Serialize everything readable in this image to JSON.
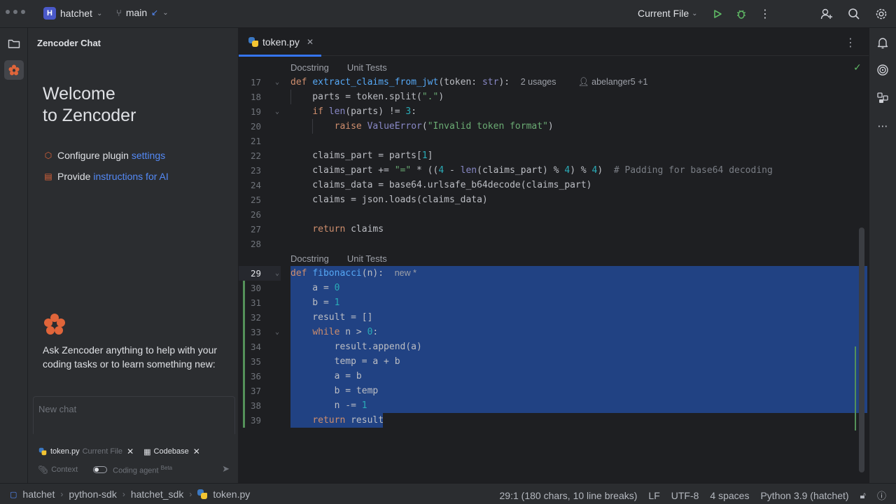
{
  "titlebar": {
    "project_badge": "H",
    "project_name": "hatchet",
    "branch": "main",
    "run_config": "Current File"
  },
  "chat": {
    "panel_title": "Zencoder Chat",
    "welcome_line1": "Welcome",
    "welcome_line2": "to Zencoder",
    "configure_prefix": "Configure plugin ",
    "configure_link": "settings",
    "instructions_prefix": "Provide ",
    "instructions_link": "instructions for AI",
    "ask_text": "Ask Zencoder anything to help with your coding tasks or to learn something new:",
    "new_chat_placeholder": "New chat",
    "chip_file": "token.py",
    "chip_file_tag": "Current File",
    "chip_codebase": "Codebase",
    "context_label": "Context",
    "coding_agent_label": "Coding agent",
    "beta_label": "Beta"
  },
  "editor": {
    "tab_name": "token.py",
    "hint_docstring": "Docstring",
    "hint_unit_tests": "Unit Tests",
    "usages": "2 usages",
    "author": "abelanger5 +1",
    "new_marker": "new *",
    "line_numbers": [
      "17",
      "18",
      "19",
      "20",
      "21",
      "22",
      "23",
      "24",
      "25",
      "26",
      "27",
      "28",
      "29",
      "30",
      "31",
      "32",
      "33",
      "34",
      "35",
      "36",
      "37",
      "38",
      "39"
    ]
  },
  "statusbar": {
    "crumb1": "hatchet",
    "crumb2": "python-sdk",
    "crumb3": "hatchet_sdk",
    "crumb4": "token.py",
    "position": "29:1 (180 chars, 10 line breaks)",
    "line_sep": "LF",
    "encoding": "UTF-8",
    "indent": "4 spaces",
    "interpreter": "Python 3.9 (hatchet)"
  },
  "colors": {
    "accent": "#3574f0",
    "selection": "#214283",
    "zencoder": "#e0653a"
  }
}
